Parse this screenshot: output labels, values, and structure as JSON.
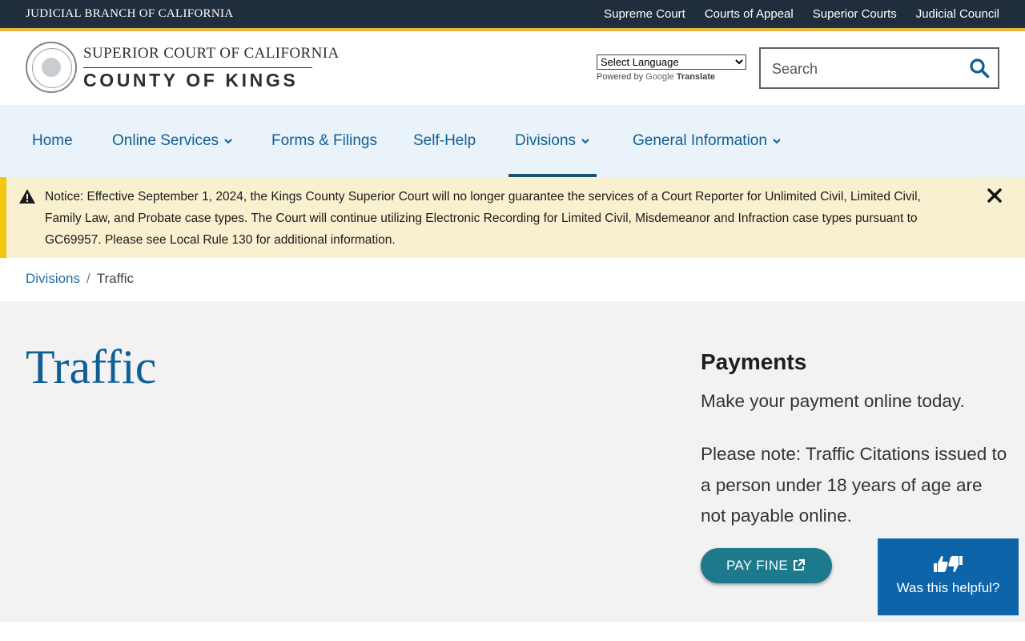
{
  "utility": {
    "brand": "JUDICIAL BRANCH OF CALIFORNIA",
    "links": [
      "Supreme Court",
      "Courts of Appeal",
      "Superior Courts",
      "Judicial Council"
    ]
  },
  "header": {
    "logo_top": "SUPERIOR COURT OF CALIFORNIA",
    "logo_bottom": "COUNTY OF KINGS",
    "language_select": "Select Language",
    "powered_by": "Powered by",
    "google": "Google",
    "translate": "Translate",
    "search_placeholder": "Search"
  },
  "nav": {
    "items": [
      {
        "label": "Home"
      },
      {
        "label": "Online Services"
      },
      {
        "label": "Forms & Filings"
      },
      {
        "label": "Self-Help"
      },
      {
        "label": "Divisions"
      },
      {
        "label": "General Information"
      }
    ]
  },
  "notice": {
    "text": "Notice: Effective September 1, 2024, the Kings County Superior Court will no longer guarantee the services of a Court Reporter for Unlimited Civil, Limited Civil, Family Law, and Probate case types. The Court will continue utilizing Electronic Recording for Limited Civil, Misdemeanor and Infraction case types pursuant to GC69957. Please see Local Rule 130 for additional information."
  },
  "breadcrumb": {
    "parent": "Divisions",
    "separator": "/",
    "current": "Traffic"
  },
  "main": {
    "title": "Traffic",
    "payments_heading": "Payments",
    "payments_p1": "Make your payment online today.",
    "payments_p2": "Please note: Traffic Citations issued to a person under 18 years of age are not payable online.",
    "pay_button": "PAY FINE"
  },
  "helpful": {
    "label": "Was this helpful?"
  },
  "colors": {
    "utility_bg": "#1f2d3d",
    "utility_accent": "#e8b73f",
    "nav_bg": "#eaf3fa",
    "link": "#0f5f94",
    "notice_bg": "#f8f0cf",
    "notice_accent": "#f2c70f",
    "pay_button": "#1d7a8c",
    "helpful_bg": "#0e64a8"
  }
}
